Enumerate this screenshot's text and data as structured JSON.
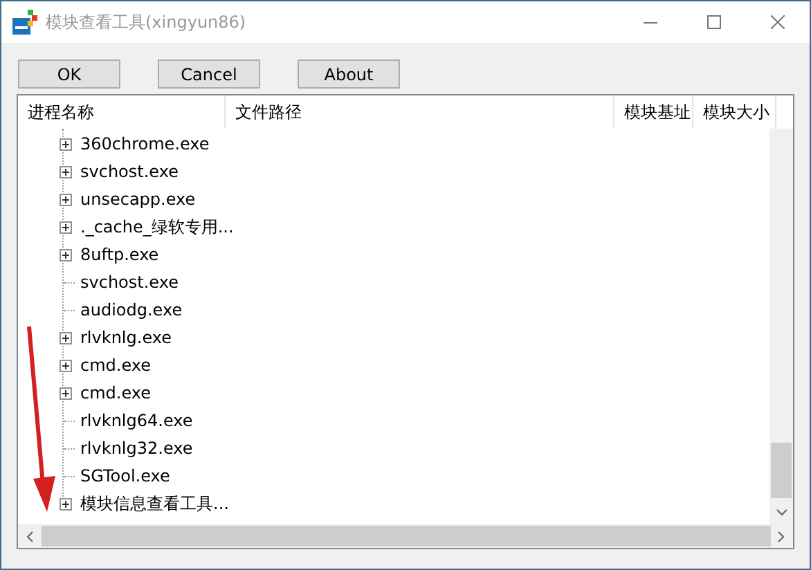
{
  "window": {
    "title": "模块查看工具(xingyun86)"
  },
  "buttons": [
    "OK",
    "Cancel",
    "About"
  ],
  "table": {
    "columns": [
      "进程名称",
      "文件路径",
      "模块基址",
      "模块大小"
    ],
    "rows": [
      {
        "name": "360chrome.exe",
        "expandable": true
      },
      {
        "name": "svchost.exe",
        "expandable": true
      },
      {
        "name": "unsecapp.exe",
        "expandable": true
      },
      {
        "name": "._cache_绿软专用...",
        "expandable": true
      },
      {
        "name": "8uftp.exe",
        "expandable": true
      },
      {
        "name": "svchost.exe",
        "expandable": false
      },
      {
        "name": "audiodg.exe",
        "expandable": false
      },
      {
        "name": "rlvknlg.exe",
        "expandable": true
      },
      {
        "name": "cmd.exe",
        "expandable": true
      },
      {
        "name": "cmd.exe",
        "expandable": true
      },
      {
        "name": "rlvknlg64.exe",
        "expandable": false
      },
      {
        "name": "rlvknlg32.exe",
        "expandable": false
      },
      {
        "name": "SGTool.exe",
        "expandable": false
      },
      {
        "name": "模块信息查看工具...",
        "expandable": true
      }
    ]
  }
}
